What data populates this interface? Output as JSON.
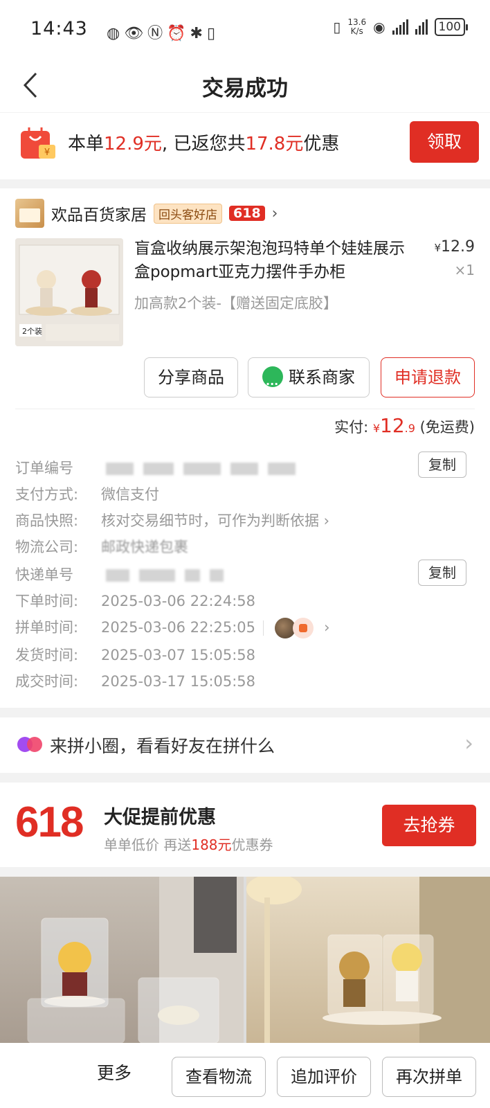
{
  "status_bar": {
    "time": "14:43",
    "net_speed_top": "13.6",
    "net_speed_bottom": "K/s",
    "battery": "100"
  },
  "nav": {
    "title": "交易成功"
  },
  "promo": {
    "prefix": "本单",
    "amount1": "12.9元",
    "middle": ", 已返您共",
    "amount2": "17.8元",
    "suffix": "优惠",
    "button": "领取"
  },
  "shop": {
    "name": "欢品百货家居",
    "badge": "回头客好店",
    "badge_618": "618"
  },
  "product": {
    "title": "盲盒收纳展示架泡泡玛特单个娃娃展示盒popmart亚克力摆件手办柜",
    "spec": "加高款2个装-【赠送固定底胶】",
    "price_symbol": "¥",
    "price_int": "12",
    "price_dec": ".9",
    "qty": "×1"
  },
  "actions": {
    "share": "分享商品",
    "contact": "联系商家",
    "refund": "申请退款"
  },
  "payment": {
    "label": "实付: ",
    "symbol": "¥",
    "amount_int": "12",
    "amount_dec": ".9",
    "note": " (免运费)"
  },
  "order_info": {
    "order_no_label": "订单编号",
    "pay_method_label": "支付方式:",
    "pay_method": "微信支付",
    "snapshot_label": "商品快照:",
    "snapshot": "核对交易细节时，可作为判断依据",
    "logistics_label": "物流公司:",
    "logistics": "邮政快递包裹",
    "tracking_label": "快递单号",
    "order_time_label": "下单时间:",
    "order_time": "2025-03-06 22:24:58",
    "group_time_label": "拼单时间:",
    "group_time": "2025-03-06 22:25:05",
    "ship_time_label": "发货时间:",
    "ship_time": "2025-03-07 15:05:58",
    "deal_time_label": "成交时间:",
    "deal_time": "2025-03-17 15:05:58",
    "copy": "复制"
  },
  "circle": {
    "text": "来拼小圈，看看好友在拼什么"
  },
  "sale": {
    "logo": "618",
    "title": "大促提前优惠",
    "sub_prefix": "单单低价 再送",
    "sub_amount": "188元",
    "sub_suffix": "优惠券",
    "button": "去抢券"
  },
  "bottom": {
    "more": "更多",
    "logistics": "查看物流",
    "review": "追加评价",
    "rebuy": "再次拼单"
  },
  "colors": {
    "accent": "#e02e24",
    "wechat": "#2db75a"
  }
}
